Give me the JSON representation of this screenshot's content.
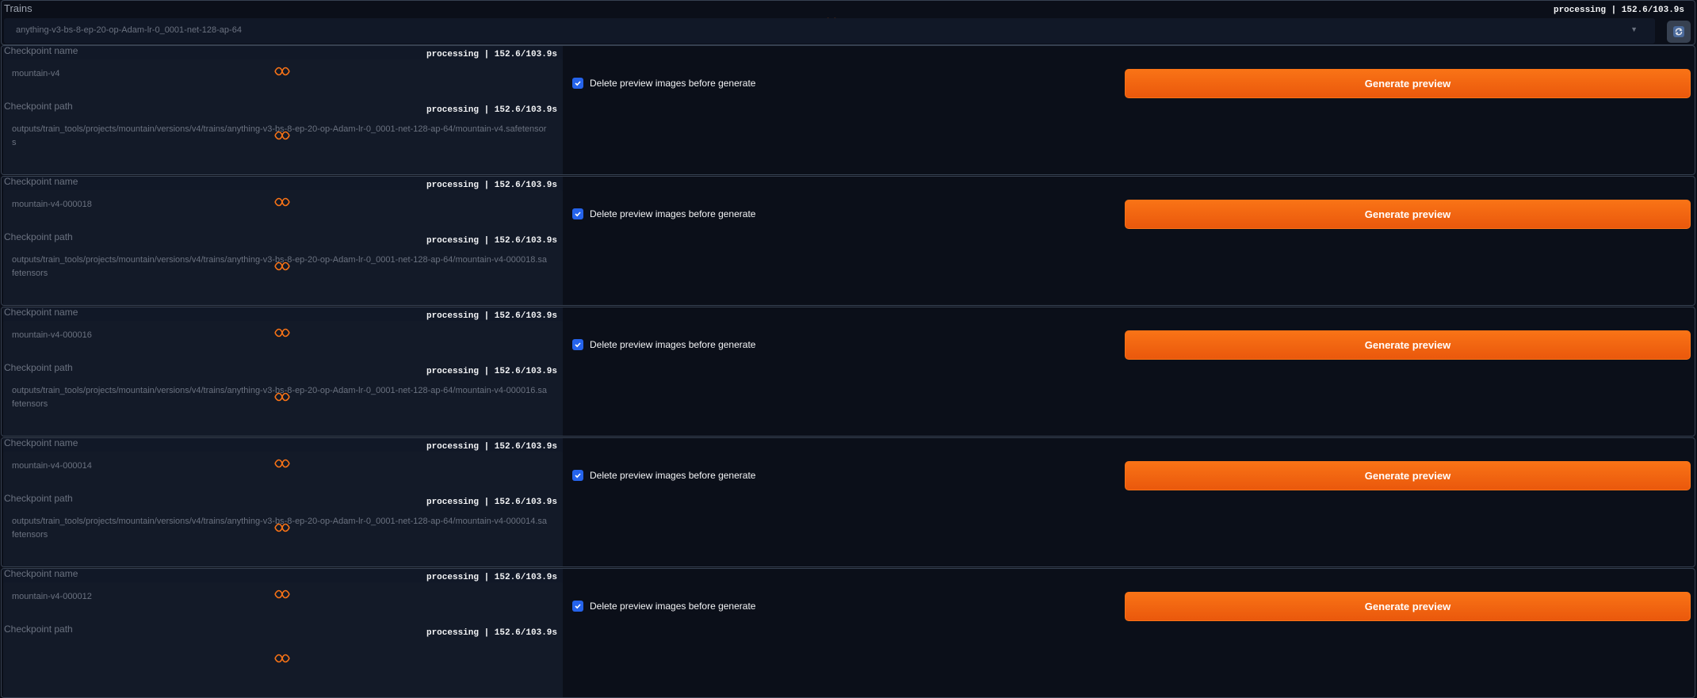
{
  "status_text": "processing | 152.6/103.9s",
  "trains": {
    "label": "Trains",
    "selected": "anything-v3-bs-8-ep-20-op-Adam-lr-0_0001-net-128-ap-64",
    "refresh_icon": "refresh-icon"
  },
  "labels": {
    "checkpoint_name": "Checkpoint name",
    "checkpoint_path": "Checkpoint path",
    "delete_checkbox": "Delete preview images before generate",
    "generate_button": "Generate preview"
  },
  "checkpoints": [
    {
      "name": "mountain-v4",
      "path": "outputs/train_tools/projects/mountain/versions/v4/trains/anything-v3-bs-8-ep-20-op-Adam-lr-0_0001-net-128-ap-64/mountain-v4.safetensors",
      "delete_checked": true
    },
    {
      "name": "mountain-v4-000018",
      "path": "outputs/train_tools/projects/mountain/versions/v4/trains/anything-v3-bs-8-ep-20-op-Adam-lr-0_0001-net-128-ap-64/mountain-v4-000018.safetensors",
      "delete_checked": true
    },
    {
      "name": "mountain-v4-000016",
      "path": "outputs/train_tools/projects/mountain/versions/v4/trains/anything-v3-bs-8-ep-20-op-Adam-lr-0_0001-net-128-ap-64/mountain-v4-000016.safetensors",
      "delete_checked": true
    },
    {
      "name": "mountain-v4-000014",
      "path": "outputs/train_tools/projects/mountain/versions/v4/trains/anything-v3-bs-8-ep-20-op-Adam-lr-0_0001-net-128-ap-64/mountain-v4-000014.safetensors",
      "delete_checked": true
    },
    {
      "name": "mountain-v4-000012",
      "path": "",
      "delete_checked": true
    }
  ],
  "colors": {
    "accent": "#f97316",
    "checkbox": "#2563eb",
    "background": "#0b0f19"
  }
}
